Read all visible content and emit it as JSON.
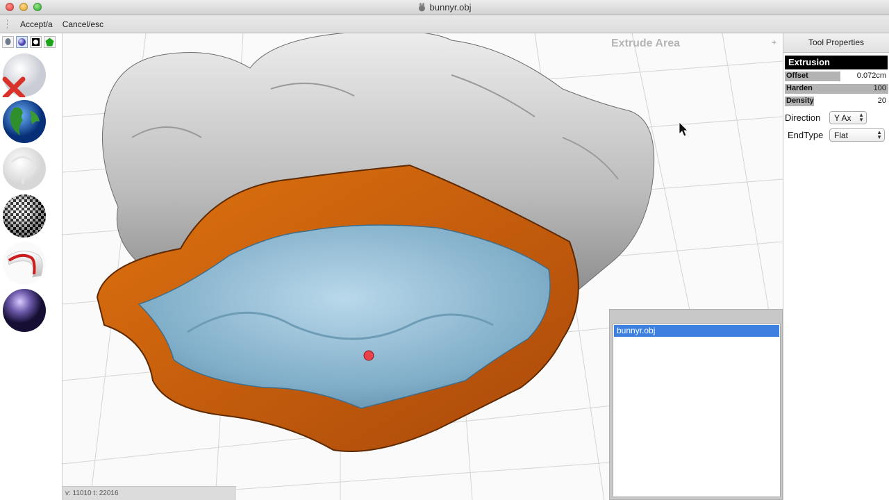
{
  "window": {
    "title": "bunnyr.obj"
  },
  "toolbar": {
    "accept_label": "Accept/a",
    "cancel_label": "Cancel/esc"
  },
  "viewport": {
    "mode_label": "Extrude Area",
    "status_text": "v: 11010  t: 22016",
    "plus": "+"
  },
  "object_list": {
    "items": [
      "bunnyr.obj"
    ]
  },
  "properties": {
    "header": "Tool Properties",
    "section": "Extrusion",
    "offset": {
      "label": "Offset",
      "value": "0.072cm",
      "fill": 0.6
    },
    "harden": {
      "label": "Harden",
      "value": "100",
      "fill": 1.0
    },
    "density": {
      "label": "Density",
      "value": "20",
      "fill": 0.28
    },
    "direction": {
      "label": "Direction",
      "value": "Y Ax"
    },
    "endtype": {
      "label": "EndType",
      "value": "Flat"
    }
  },
  "colors": {
    "extrusion_orange": "#c75a06",
    "interior_blue": "#8fbcd6",
    "selection_blue": "#3d80df"
  },
  "palette_icons": [
    "head-icon",
    "sphere-icon",
    "material-icon",
    "pentagon-icon",
    "delete-material-icon",
    "globe-icon",
    "white-swirl-icon",
    "checker-icon",
    "red-stripe-icon",
    "purple-sphere-icon"
  ]
}
